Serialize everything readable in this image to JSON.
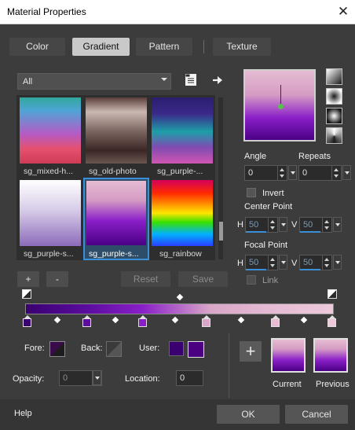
{
  "window": {
    "title": "Material Properties"
  },
  "tabs": [
    {
      "label": "Color",
      "active": false
    },
    {
      "label": "Gradient",
      "active": true
    },
    {
      "label": "Pattern",
      "active": false
    },
    {
      "label": "Texture",
      "active": false
    }
  ],
  "category": {
    "value": "All"
  },
  "gallery": {
    "items": [
      {
        "name": "sg_mixed-h...",
        "selected": false
      },
      {
        "name": "sg_old-photo",
        "selected": false
      },
      {
        "name": "sg_purple-...",
        "selected": false
      },
      {
        "name": "sg_purple-s...",
        "selected": false
      },
      {
        "name": "sg_purple-s...",
        "selected": true
      },
      {
        "name": "sg_rainbow",
        "selected": false
      }
    ]
  },
  "gallery_buttons": {
    "add": "+",
    "remove": "-",
    "reset": "Reset",
    "save": "Save"
  },
  "angle": {
    "label": "Angle",
    "value": "0"
  },
  "repeats": {
    "label": "Repeats",
    "value": "0"
  },
  "invert": {
    "label": "Invert",
    "checked": false
  },
  "center_point": {
    "label": "Center Point",
    "h_label": "H",
    "h_value": "50",
    "v_label": "V",
    "v_value": "50"
  },
  "focal_point": {
    "label": "Focal Point",
    "h_label": "H",
    "h_value": "50",
    "v_label": "V",
    "v_value": "50"
  },
  "link": {
    "label": "Link",
    "checked": false
  },
  "stops": {
    "colors": [
      "#3a0070",
      "#5b0d9e",
      "#8a1fc8",
      "#d9a6c8",
      "#e6bdd4",
      "#ecc9db"
    ]
  },
  "fore": {
    "label": "Fore:"
  },
  "back": {
    "label": "Back:"
  },
  "user": {
    "label": "User:",
    "color": "#4b0082"
  },
  "opacity": {
    "label": "Opacity:",
    "value": "0"
  },
  "location": {
    "label": "Location:",
    "value": "0"
  },
  "add_swatch": {
    "label": "+"
  },
  "current": {
    "label": "Current"
  },
  "previous": {
    "label": "Previous"
  },
  "footer": {
    "help": "Help",
    "ok": "OK",
    "cancel": "Cancel"
  },
  "colors": {
    "accent": "#3b8fd8",
    "panel": "#3c3c3c",
    "active_tab": "#c9c9c9"
  }
}
